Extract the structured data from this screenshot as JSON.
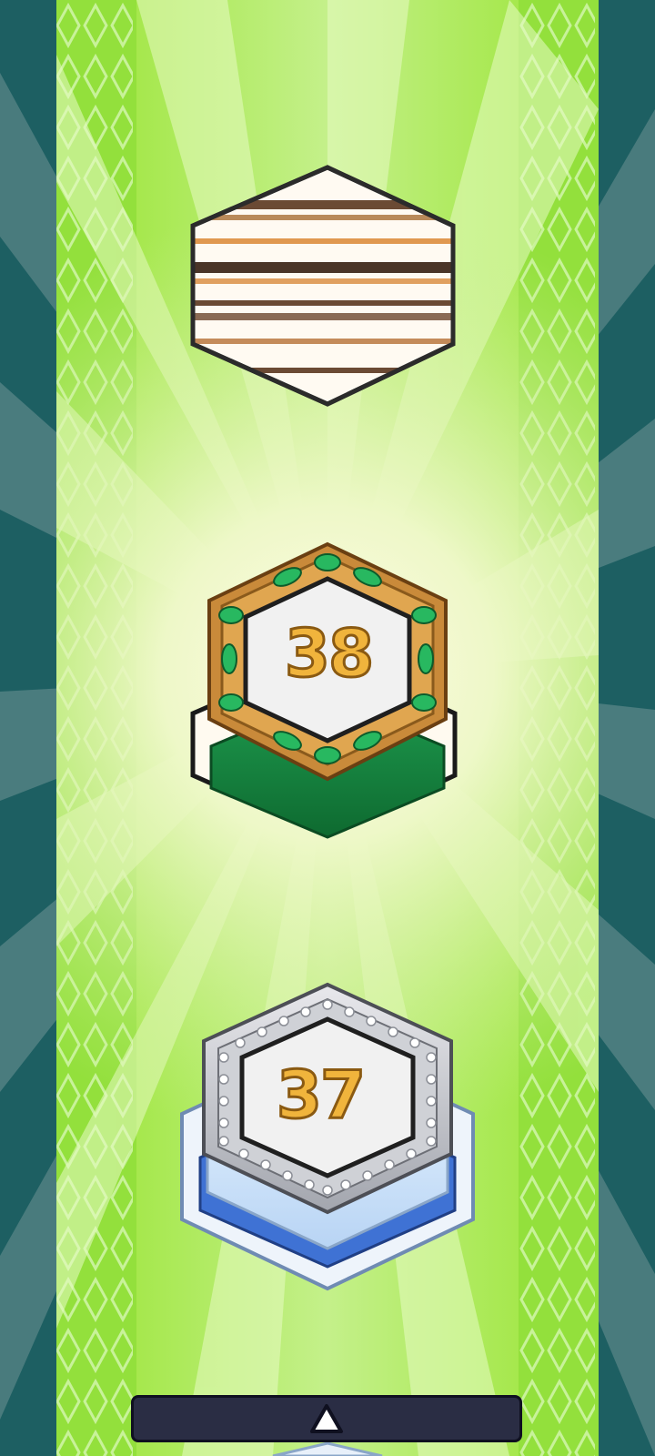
{
  "level_path": {
    "tiles": [
      {
        "id": "locked-tile",
        "state": "locked",
        "label": ""
      },
      {
        "id": "level-38",
        "state": "current",
        "label": "38",
        "style": "emerald"
      },
      {
        "id": "level-37",
        "state": "completed",
        "label": "37",
        "style": "diamond"
      }
    ]
  },
  "labels": {
    "level_38": "38",
    "level_37": "37"
  },
  "controls": {
    "scroll_up_icon": "up-triangle-icon"
  },
  "colors": {
    "outer_bg": "#1d5f62",
    "track_green": "#8fe03a",
    "track_light": "#d9f5a8",
    "number_gold": "#f0b43c",
    "emerald": "#22a35a",
    "bar_dark": "#2a2d44"
  }
}
